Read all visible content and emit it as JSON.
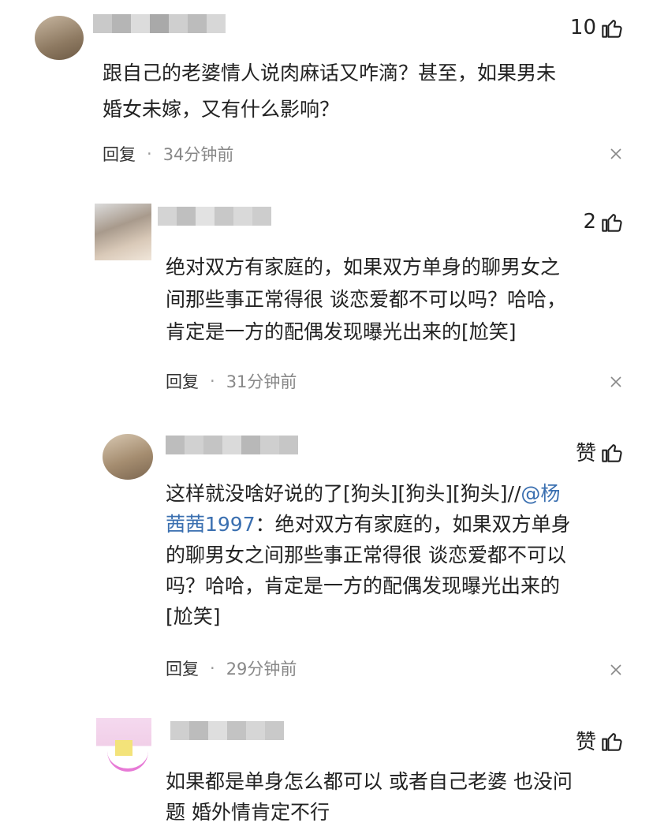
{
  "colors": {
    "mention": "#3a6fb0",
    "meta_time": "#888888",
    "text": "#222222"
  },
  "comments": [
    {
      "likes": "10",
      "text_lines": [
        "跟自己的老婆情人说肉麻话又咋滴？甚至，如果男未",
        "婚女未嫁，又有什么影响？"
      ],
      "reply_label": "回复",
      "time": "34分钟前"
    },
    {
      "likes": "2",
      "text_lines": [
        "绝对双方有家庭的，如果双方单身的聊男女之",
        "间那些事正常得很 谈恋爱都不可以吗？哈哈，",
        "肯定是一方的配偶发现曝光出来的[尬笑]"
      ],
      "reply_label": "回复",
      "time": "31分钟前"
    },
    {
      "likes": "赞",
      "line1_prefix": "这样就没啥好说的了[狗头][狗头][狗头]//",
      "mention_a": "@杨",
      "mention_b": "茜茜1997",
      "line2_rest": "：绝对双方有家庭的，如果双方单身",
      "text_lines_rest": [
        "的聊男女之间那些事正常得很 谈恋爱都不可以",
        "吗？哈哈，肯定是一方的配偶发现曝光出来的",
        "[尬笑]"
      ],
      "reply_label": "回复",
      "time": "29分钟前"
    },
    {
      "likes": "赞",
      "text_lines": [
        "如果都是单身怎么都可以 或者自己老婆 也没问",
        "题 婚外情肯定不行"
      ]
    }
  ],
  "icons": {
    "like": "thumbs-up-icon",
    "close": "close-icon"
  }
}
